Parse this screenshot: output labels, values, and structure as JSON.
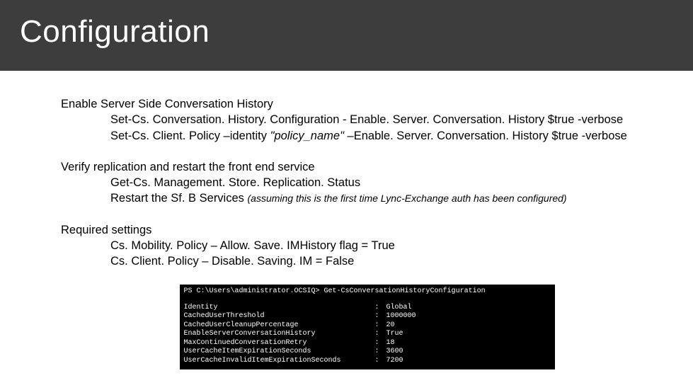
{
  "title": "Configuration",
  "section1": {
    "heading": "Enable Server Side Conversation History",
    "line1": "Set-Cs. Conversation. History. Configuration - Enable. Server. Conversation. History $true -verbose",
    "line2a": "Set-Cs. Client. Policy –identity ",
    "line2b": "\"policy_name\"",
    "line2c": " –Enable. Server. Conversation. History $true -verbose"
  },
  "section2": {
    "heading": "Verify replication and restart the front end service",
    "line1": "Get-Cs. Management. Store. Replication. Status",
    "line2a": "Restart the Sf. B Services ",
    "line2b": "(assuming this is the first time Lync-Exchange auth has been configured)"
  },
  "section3": {
    "heading": "Required settings",
    "line1": "Cs. Mobility. Policy – Allow. Save. IMHistory flag = True",
    "line2": "Cs. Client. Policy – Disable. Saving. IM = False"
  },
  "terminal": {
    "prompt": "PS C:\\Users\\administrator.OCSIQ> Get-CsConversationHistoryConfiguration",
    "rows": [
      {
        "k": "Identity",
        "v": "Global"
      },
      {
        "k": "CachedUserThreshold",
        "v": "1000000"
      },
      {
        "k": "CachedUserCleanupPercentage",
        "v": "20"
      },
      {
        "k": "EnableServerConversationHistory",
        "v": "True"
      },
      {
        "k": "MaxContinuedConversationRetry",
        "v": "18"
      },
      {
        "k": "UserCacheItemExpirationSeconds",
        "v": "3600"
      },
      {
        "k": "UserCacheInvalidItemExpirationSeconds",
        "v": "7200"
      }
    ]
  }
}
